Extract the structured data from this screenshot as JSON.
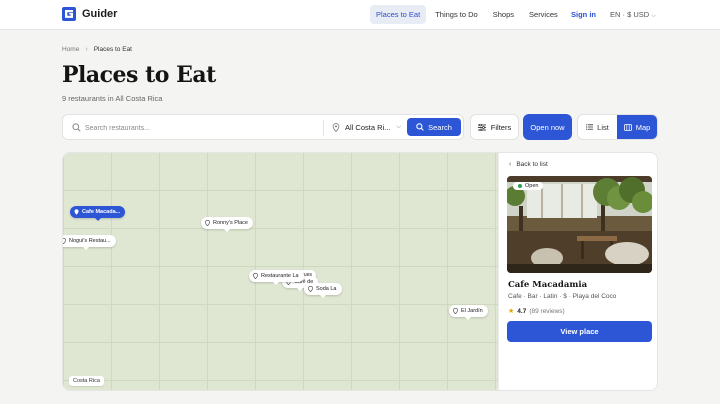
{
  "header": {
    "brand": "Guider",
    "nav": [
      "Places to Eat",
      "Things to Do",
      "Shops",
      "Services"
    ],
    "active_nav": "Places to Eat",
    "signin": "Sign in",
    "locale": "EN · $ USD"
  },
  "breadcrumb": {
    "home": "Home",
    "sep": "›",
    "current": "Places to Eat"
  },
  "page": {
    "title": "Places to Eat",
    "subtitle": "9 restaurants in All Costa Rica"
  },
  "toolbar": {
    "search_placeholder": "Search restaurants...",
    "location": "All Costa Ri...",
    "search_label": "Search",
    "filters_label": "Filters",
    "open_now_label": "Open now",
    "list_label": "List",
    "map_label": "Map",
    "active_view": "Map"
  },
  "map": {
    "region_label": "Costa Rica",
    "pins": [
      {
        "label": "Cafe Macada...",
        "selected": true
      },
      {
        "label": "Ronny's Place",
        "selected": false
      },
      {
        "label": "Nogui's Restau...",
        "selected": false
      },
      {
        "label": "Restaurante La",
        "selected": false
      },
      {
        "label": "Café de",
        "selected": false
      },
      {
        "label": "Soda La",
        "selected": false
      },
      {
        "label": "El Jardín",
        "selected": false
      }
    ]
  },
  "detail": {
    "back": "Back to list",
    "badge": "Open",
    "name": "Cafe Macadamia",
    "meta": "Cafe · Bar · Latin · $ · Playa del Coco",
    "rating": "4.7",
    "reviews": "(89 reviews)",
    "cta": "View place"
  },
  "colors": {
    "accent": "#2d56d6",
    "map_bg": "#dfe7d3",
    "open_dot": "#2f9b55"
  }
}
